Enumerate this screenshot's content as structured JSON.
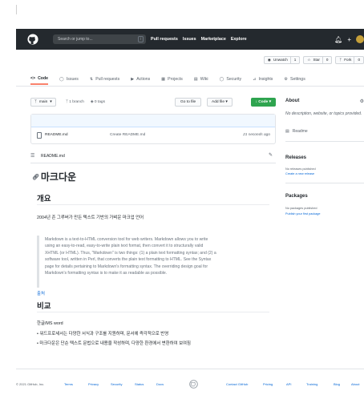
{
  "header": {
    "search_placeholder": "Search or jump to...",
    "search_key": "/",
    "nav": [
      "Pull requests",
      "Issues",
      "Marketplace",
      "Explore"
    ]
  },
  "repo_actions": {
    "watch": "Unwatch",
    "watch_count": "1",
    "star": "Star",
    "star_count": "0",
    "fork": "Fork",
    "fork_count": "0"
  },
  "tabs": [
    "Code",
    "Issues",
    "Pull requests",
    "Actions",
    "Projects",
    "Wiki",
    "Security",
    "Insights",
    "Settings"
  ],
  "branch": {
    "name": "main",
    "branches": "1 branch",
    "tags": "0 tags",
    "goto_file": "Go to file",
    "add_file": "Add file",
    "code": "Code"
  },
  "files": [
    {
      "name": "README.md",
      "message": "Create README.md",
      "age": "21 seconds ago"
    }
  ],
  "readme": {
    "label": "README.md",
    "h1": "마크다운",
    "section1_title": "개요",
    "intro": "2004년 존 그루버가 만든 텍스트 기반의 가벼운 마크업 언어",
    "quote_lines": [
      "Markdown is a text-to-HTML conversion tool for web writers. Markdown allows you to write",
      "using an easy-to-read, easy-to-write plain text format, then convert it to structurally valid",
      "XHTML (or HTML). Thus, \"Markdown\" is two things: (1) a plain text formatting syntax; and (2) a",
      "software tool, written in Perl, that converts the plain text formatting to HTML. See the Syntax",
      "page for details pertaining to Markdown's formatting syntax. The overriding design goal for",
      "Markdown's formatting syntax is to make it as readable as possible."
    ],
    "source_link": "출처",
    "section2_title": "비교",
    "compare_intro": "한글/MS word",
    "bullets": [
      "워드프로세서는 다양한 서식과 구조를 지원하며, 문서에 즉각적으로 반영",
      "마크다운은 단순 텍스트 문법으로 내용을 작성하며, 다양한 환경에서 변환하여 보여짐"
    ]
  },
  "sidebar": {
    "about_title": "About",
    "about_desc": "No description, website, or topics provided.",
    "readme_link": "Readme",
    "releases_title": "Releases",
    "releases_none": "No releases published",
    "releases_create": "Create a new release",
    "packages_title": "Packages",
    "packages_none": "No packages published",
    "packages_publish": "Publish your first package"
  },
  "footer": {
    "copyright": "© 2021 GitHub, Inc.",
    "left_links": [
      "Terms",
      "Privacy",
      "Security",
      "Status",
      "Docs"
    ],
    "right_links": [
      "Contact GitHub",
      "Pricing",
      "API",
      "Training",
      "Blog",
      "About"
    ]
  }
}
